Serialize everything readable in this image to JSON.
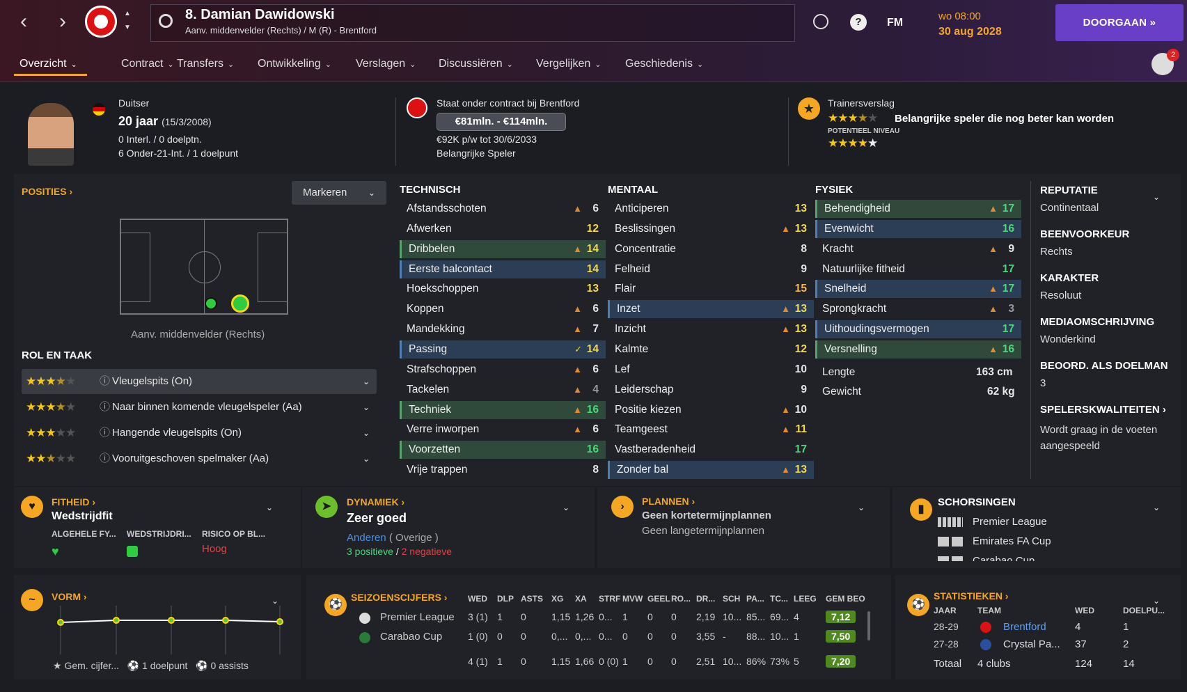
{
  "header": {
    "title": "8. Damian Dawidowski",
    "subtitle": "Aanv. middenvelder (Rechts) / M (R) - Brentford",
    "fm": "FM",
    "time": "wo 08:00",
    "date": "30 aug 2028",
    "continue": "DOORGAAN",
    "notif_count": "2"
  },
  "tabs": [
    "Overzicht",
    "Contract",
    "Transfers",
    "Ontwikkeling",
    "Verslagen",
    "Discussiëren",
    "Vergelijken",
    "Geschiedenis"
  ],
  "info": {
    "nationality": "Duitser",
    "age": "20 jaar",
    "dob": "(15/3/2008)",
    "caps": "0 Interl. / 0 doelptn.",
    "u21": "6 Onder-21-Int. / 1 doelpunt",
    "contract_club": "Staat onder contract bij Brentford",
    "value": "€81mln. - €114mln.",
    "wage": "€92K p/w tot 30/6/2033",
    "status": "Belangrijke Speler",
    "coach_report": "Trainersverslag",
    "coach_text": "Belangrijke speler die nog beter kan worden",
    "potential_label": "POTENTIEEL NIVEAU",
    "current_stars": 3.5,
    "potential_stars": 4.5
  },
  "positions": {
    "title": "POSITIES",
    "mark": "Markeren",
    "caption": "Aanv. middenvelder (Rechts)"
  },
  "roles": {
    "title": "ROL EN TAAK",
    "items": [
      {
        "name": "Vleugelspits (On)",
        "stars": 3.5
      },
      {
        "name": "Naar binnen komende vleugelspeler (Aa)",
        "stars": 3.5
      },
      {
        "name": "Hangende vleugelspits (On)",
        "stars": 3
      },
      {
        "name": "Vooruitgeschoven spelmaker (Aa)",
        "stars": 2.5
      }
    ]
  },
  "technical": {
    "title": "TECHNISCH",
    "rows": [
      [
        "Afstandsschoten",
        "6",
        "up",
        ""
      ],
      [
        "Afwerken",
        "12",
        "",
        ""
      ],
      [
        "Dribbelen",
        "14",
        "up",
        "g"
      ],
      [
        "Eerste balcontact",
        "14",
        "",
        "b"
      ],
      [
        "Hoekschoppen",
        "13",
        "",
        ""
      ],
      [
        "Koppen",
        "6",
        "up",
        ""
      ],
      [
        "Mandekking",
        "7",
        "up",
        ""
      ],
      [
        "Passing",
        "14",
        "tick",
        "b"
      ],
      [
        "Strafschoppen",
        "6",
        "up",
        ""
      ],
      [
        "Tackelen",
        "4",
        "up",
        ""
      ],
      [
        "Techniek",
        "16",
        "up",
        "g"
      ],
      [
        "Verre inworpen",
        "6",
        "up",
        ""
      ],
      [
        "Voorzetten",
        "16",
        "",
        "g"
      ],
      [
        "Vrije trappen",
        "8",
        "",
        ""
      ]
    ]
  },
  "mental": {
    "title": "MENTAAL",
    "rows": [
      [
        "Anticiperen",
        "13",
        "",
        ""
      ],
      [
        "Beslissingen",
        "13",
        "up",
        ""
      ],
      [
        "Concentratie",
        "8",
        "",
        ""
      ],
      [
        "Felheid",
        "9",
        "",
        ""
      ],
      [
        "Flair",
        "15",
        "",
        ""
      ],
      [
        "Inzet",
        "13",
        "up",
        "b"
      ],
      [
        "Inzicht",
        "13",
        "up",
        ""
      ],
      [
        "Kalmte",
        "12",
        "",
        ""
      ],
      [
        "Lef",
        "10",
        "",
        ""
      ],
      [
        "Leiderschap",
        "9",
        "",
        ""
      ],
      [
        "Positie kiezen",
        "10",
        "up",
        ""
      ],
      [
        "Teamgeest",
        "11",
        "up",
        ""
      ],
      [
        "Vastberadenheid",
        "17",
        "",
        ""
      ],
      [
        "Zonder bal",
        "13",
        "up",
        "b"
      ]
    ]
  },
  "physical": {
    "title": "FYSIEK",
    "rows": [
      [
        "Behendigheid",
        "17",
        "up",
        "g"
      ],
      [
        "Evenwicht",
        "16",
        "",
        "b"
      ],
      [
        "Kracht",
        "9",
        "up",
        ""
      ],
      [
        "Natuurlijke fitheid",
        "17",
        "",
        ""
      ],
      [
        "Snelheid",
        "17",
        "up",
        "b"
      ],
      [
        "Sprongkracht",
        "3",
        "up",
        ""
      ],
      [
        "Uithoudingsvermogen",
        "17",
        "",
        "b"
      ],
      [
        "Versnelling",
        "16",
        "up",
        "g"
      ]
    ],
    "height_label": "Lengte",
    "height": "163 cm",
    "weight_label": "Gewicht",
    "weight": "62 kg"
  },
  "side": [
    {
      "h": "REPUTATIE",
      "v": "Continentaal"
    },
    {
      "h": "BEENVOORKEUR",
      "v": "Rechts"
    },
    {
      "h": "KARAKTER",
      "v": "Resoluut"
    },
    {
      "h": "MEDIAOMSCHRIJVING",
      "v": "Wonderkind"
    },
    {
      "h": "BEOORD. ALS DOELMAN",
      "v": "3"
    },
    {
      "h": "SPELERSKWALITEITEN",
      "v": "Wordt graag in de voeten aangespeeld"
    }
  ],
  "fitness": {
    "title": "FITHEID",
    "value": "Wedstrijdfit",
    "c1": "ALGEHELE FY...",
    "c2": "WEDSTRIJDRI...",
    "c3": "RISICO OP BL...",
    "risk": "Hoog"
  },
  "dynamics": {
    "title": "DYNAMIEK",
    "value": "Zeer goed",
    "group": "Anderen",
    "group2": "( Overige )",
    "pos": "3 positieve",
    "sep": "/",
    "neg": "2 negatieve"
  },
  "plans": {
    "title": "PLANNEN",
    "line1": "Geen kortetermijnplannen",
    "line2": "Geen langetermijnplannen"
  },
  "susp": {
    "title": "SCHORSINGEN",
    "items": [
      "Premier League",
      "Emirates FA Cup",
      "Carabao Cup"
    ]
  },
  "form": {
    "title": "VORM",
    "avg": "Gem. cijfer...",
    "goals": "1 doelpunt",
    "assists": "0 assists"
  },
  "season": {
    "title": "SEIZOENSCIJFERS",
    "cols": [
      "WED",
      "DLP",
      "ASTS",
      "XG",
      "XA",
      "STRF",
      "MVW",
      "GEEL",
      "RO...",
      "DR...",
      "SCH",
      "PA...",
      "TC...",
      "LEEG",
      "GEM BEO"
    ],
    "rows": [
      {
        "comp": "Premier League",
        "v": [
          "3 (1)",
          "1",
          "0",
          "1,15",
          "1,26",
          "0...",
          "1",
          "0",
          "0",
          "2,19",
          "10...",
          "85...",
          "69...",
          "4"
        ],
        "r": "7,12"
      },
      {
        "comp": "Carabao Cup",
        "v": [
          "1 (0)",
          "0",
          "0",
          "0,...",
          "0,...",
          "0...",
          "0",
          "0",
          "0",
          "3,55",
          "-",
          "88...",
          "10...",
          "1"
        ],
        "r": "7,50"
      }
    ],
    "total": {
      "v": [
        "4 (1)",
        "1",
        "0",
        "1,15",
        "1,66",
        "0 (0)",
        "1",
        "0",
        "0",
        "2,51",
        "10...",
        "86%",
        "73%",
        "5"
      ],
      "r": "7,20"
    }
  },
  "stats": {
    "title": "STATISTIEKEN",
    "cols": [
      "JAAR",
      "TEAM",
      "WED",
      "DOELPU..."
    ],
    "rows": [
      [
        "28-29",
        "Brentford",
        "4",
        "1"
      ],
      [
        "27-28",
        "Crystal Pa...",
        "37",
        "2"
      ]
    ],
    "total": [
      "Totaal",
      "4 clubs",
      "124",
      "14"
    ]
  },
  "colors": {
    "accent": "#f5a623",
    "purple": "#6a3fc7",
    "green": "#4ad97a"
  }
}
